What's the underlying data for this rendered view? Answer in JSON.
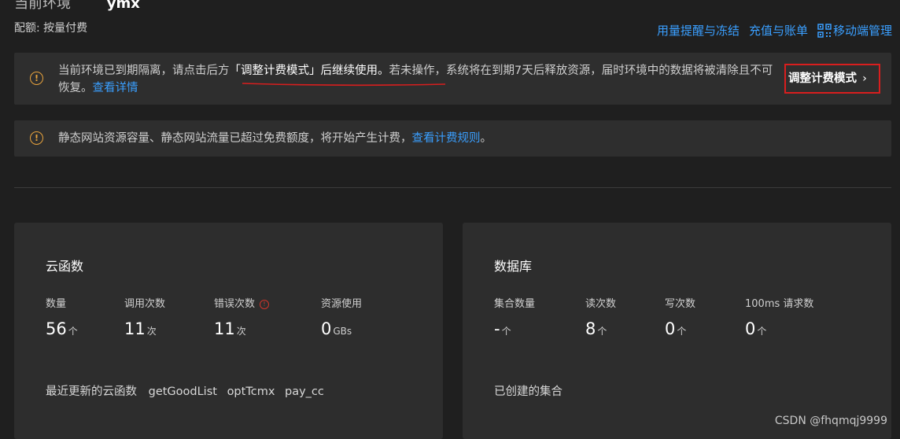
{
  "header": {
    "env_label_partial": "当前环境",
    "env_name_partial": "ymx",
    "quota_text": "配额: 按量付费",
    "links": [
      "用量提醒与冻结",
      "充值与账单",
      "移动端管理"
    ]
  },
  "alert_expired": {
    "text_before": "当前环境已到期隔离，请点击后方",
    "text_highlight": "「调整计费模式」后继续使用。",
    "text_after": "若未操作，系统将在到期7天后释放资源，届时环境中的数据将被清除且不可恢复。",
    "link": "查看详情",
    "button_label": "调整计费模式",
    "button_chevron": "›"
  },
  "alert_billing": {
    "text": "静态网站资源容量、静态网站流量已超过免费额度，将开始产生计费，",
    "link": "查看计费规则",
    "suffix": "。"
  },
  "cloud_functions": {
    "title": "云函数",
    "stats": [
      {
        "label": "数量",
        "value": "56",
        "unit": "个"
      },
      {
        "label": "调用次数",
        "value": "11",
        "unit": "次"
      },
      {
        "label": "错误次数",
        "value": "11",
        "unit": "次"
      },
      {
        "label": "资源使用",
        "value": "0",
        "unit": "GBs"
      }
    ],
    "recent_label": "最近更新的云函数",
    "recent_items": [
      "getGoodList",
      "optTcmx",
      "pay_cc"
    ]
  },
  "database": {
    "title": "数据库",
    "stats": [
      {
        "label": "集合数量",
        "value": "-",
        "unit": "个"
      },
      {
        "label": "读次数",
        "value": "8",
        "unit": "个"
      },
      {
        "label": "写次数",
        "value": "0",
        "unit": "个"
      },
      {
        "label": "100ms 请求数",
        "value": "0",
        "unit": "个"
      }
    ],
    "created_label": "已创建的集合"
  },
  "watermark": "CSDN @fhqmqj9999",
  "colors": {
    "link": "#3a9fff",
    "warning": "#e8a33d",
    "annotation_red": "#d81e1e",
    "background": "#1f1f1f",
    "panel": "#2d2d2d"
  }
}
